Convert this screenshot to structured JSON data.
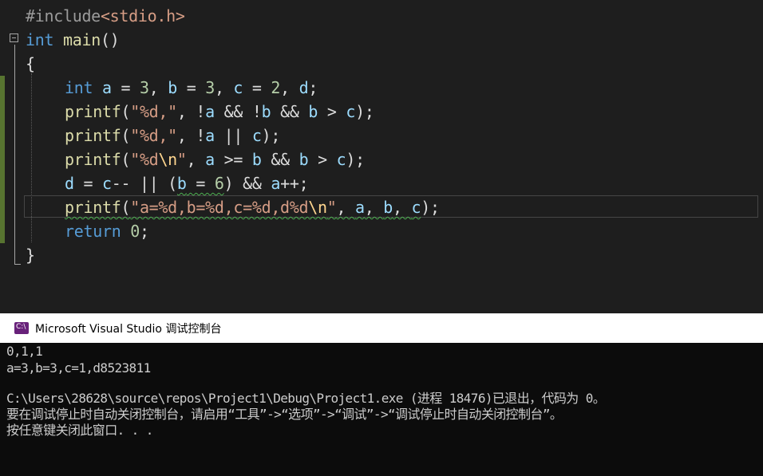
{
  "editor": {
    "lines": {
      "l1_include": "#include",
      "l1_header": "<stdio.h>",
      "l2_int": "int",
      "l2_main": "main",
      "l2_parens": "()",
      "l3": "{",
      "l4_int": "int",
      "l4_rest_a": "a",
      "l4_eq1": " = ",
      "l4_3a": "3",
      "l4_comma1": ", ",
      "l4_b": "b",
      "l4_eq2": " = ",
      "l4_3b": "3",
      "l4_comma2": ", ",
      "l4_c": "c",
      "l4_eq3": " = ",
      "l4_2": "2",
      "l4_comma3": ", ",
      "l4_d": "d",
      "l4_end": ";",
      "l5_printf": "printf",
      "l5_open": "(",
      "l5_str": "\"%d,\"",
      "l5_rest1": ", !",
      "l5_a": "a",
      "l5_rest2": " && !",
      "l5_b1": "b",
      "l5_rest3": " && ",
      "l5_b2": "b",
      "l5_rest4": " > ",
      "l5_c": "c",
      "l5_end": ");",
      "l6_printf": "printf",
      "l6_open": "(",
      "l6_str": "\"%d,\"",
      "l6_rest1": ", !",
      "l6_a": "a",
      "l6_rest2": " || ",
      "l6_c": "c",
      "l6_end": ");",
      "l7_printf": "printf",
      "l7_open": "(",
      "l7_str1": "\"%d",
      "l7_esc": "\\n",
      "l7_str2": "\"",
      "l7_rest1": ", ",
      "l7_a": "a",
      "l7_rest2": " >= ",
      "l7_b1": "b",
      "l7_rest3": " && ",
      "l7_b2": "b",
      "l7_rest4": " > ",
      "l7_c": "c",
      "l7_end": ");",
      "l8_d": "d",
      "l8_rest1": " = ",
      "l8_c": "c",
      "l8_rest2": "-- || (",
      "l8_b": "b",
      "l8_eq": " = ",
      "l8_6": "6",
      "l8_rest3": ") && ",
      "l8_a": "a",
      "l8_end": "++;",
      "l9_printf": "printf",
      "l9_open": "(",
      "l9_str1": "\"a=%d,b=%d,c=%d,d%d",
      "l9_esc": "\\n",
      "l9_str2": "\"",
      "l9_rest1": ", ",
      "l9_a": "a",
      "l9_rest2": ", ",
      "l9_b": "b",
      "l9_rest3": ", ",
      "l9_c": "c",
      "l9_end": ");",
      "l10_return": "return",
      "l10_0": "0",
      "l10_end": ";",
      "l11": "}"
    }
  },
  "console": {
    "title": "Microsoft Visual Studio 调试控制台",
    "icon_text": "C:\\",
    "output": [
      "0,1,1",
      "a=3,b=3,c=1,d8523811",
      "",
      "C:\\Users\\28628\\source\\repos\\Project1\\Debug\\Project1.exe (进程 18476)已退出，代码为 0。",
      "要在调试停止时自动关闭控制台，请启用“工具”->“选项”->“调试”->“调试停止时自动关闭控制台”。",
      "按任意键关闭此窗口. . ."
    ]
  },
  "colors": {
    "editor_bg": "#1e1e1e",
    "keyword": "#569cd6",
    "string": "#d69d85",
    "function": "#dcdcaa",
    "variable": "#9cdcfe",
    "number": "#b5cea8",
    "console_bg": "#0c0c0c",
    "change_bar": "#577430"
  },
  "icons": {
    "collapse": "collapse-minus-icon",
    "app": "visual-studio-console-icon"
  }
}
